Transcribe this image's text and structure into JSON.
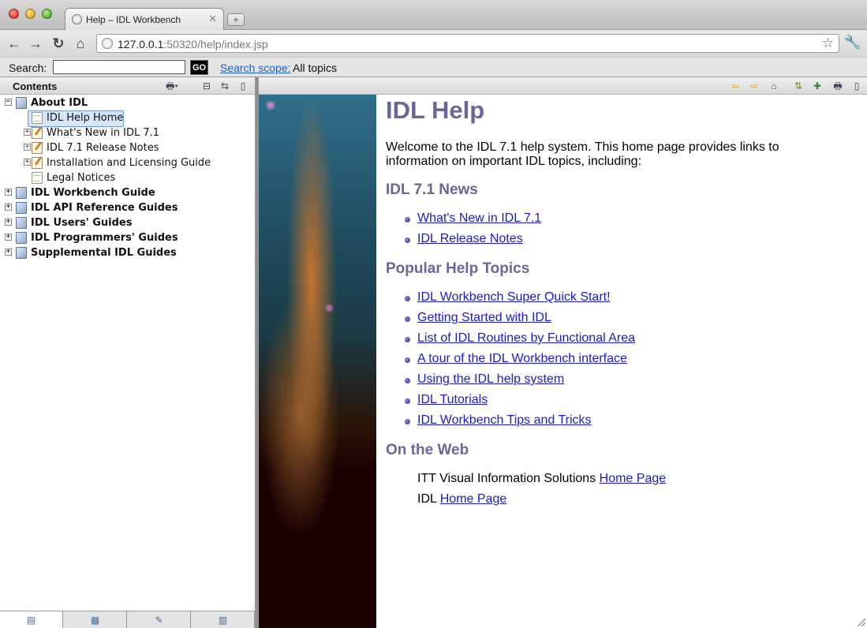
{
  "browser": {
    "tab_title": "Help – IDL Workbench",
    "tab_close": "✕",
    "new_tab": "+",
    "url_host": "127.0.0.1",
    "url_rest": ":50320/help/index.jsp"
  },
  "searchbar": {
    "label": "Search:",
    "input_value": "",
    "go_label": "GO",
    "scope_link": "Search scope:",
    "scope_value": "All topics"
  },
  "contents": {
    "title": "Contents",
    "tree": [
      {
        "label": "About IDL",
        "bold": true,
        "icon": "book",
        "level": 0,
        "expander": "−"
      },
      {
        "label": "IDL Help Home",
        "bold": false,
        "icon": "page",
        "level": 1,
        "expander": "",
        "selected": true
      },
      {
        "label": "What's New in IDL 7.1",
        "bold": false,
        "icon": "note",
        "level": 1,
        "expander": "+"
      },
      {
        "label": "IDL 7.1 Release Notes",
        "bold": false,
        "icon": "note",
        "level": 1,
        "expander": "+"
      },
      {
        "label": "Installation and Licensing Guide",
        "bold": false,
        "icon": "note",
        "level": 1,
        "expander": "+"
      },
      {
        "label": "Legal Notices",
        "bold": false,
        "icon": "page",
        "level": 1,
        "expander": ""
      },
      {
        "label": "IDL Workbench Guide",
        "bold": true,
        "icon": "book",
        "level": 0,
        "expander": "+"
      },
      {
        "label": "IDL API Reference Guides",
        "bold": true,
        "icon": "book",
        "level": 0,
        "expander": "+"
      },
      {
        "label": "IDL Users' Guides",
        "bold": true,
        "icon": "book",
        "level": 0,
        "expander": "+"
      },
      {
        "label": "IDL Programmers' Guides",
        "bold": true,
        "icon": "book",
        "level": 0,
        "expander": "+"
      },
      {
        "label": "Supplemental IDL Guides",
        "bold": true,
        "icon": "book",
        "level": 0,
        "expander": "+"
      }
    ]
  },
  "main": {
    "title": "IDL Help",
    "intro": "Welcome to the IDL 7.1 help system. This home page provides links to information on important IDL topics, including:",
    "news_heading": "IDL 7.1 News",
    "news_links": [
      "What's New in IDL 7.1",
      "IDL Release Notes"
    ],
    "popular_heading": "Popular Help Topics",
    "popular_links": [
      "IDL Workbench Super Quick Start!",
      "Getting Started with IDL",
      "List of IDL Routines by Functional Area",
      "A tour of the IDL Workbench interface",
      "Using the IDL help system",
      "IDL Tutorials",
      "IDL Workbench Tips and Tricks"
    ],
    "web_heading": "On the Web",
    "web_lines": [
      {
        "prefix": "ITT Visual Information Solutions ",
        "link": "Home Page"
      },
      {
        "prefix": "IDL ",
        "link": "Home Page"
      }
    ]
  },
  "colors": {
    "heading": "#66679a",
    "link": "#1a1ad0",
    "scope_link": "#1a5fd1"
  }
}
